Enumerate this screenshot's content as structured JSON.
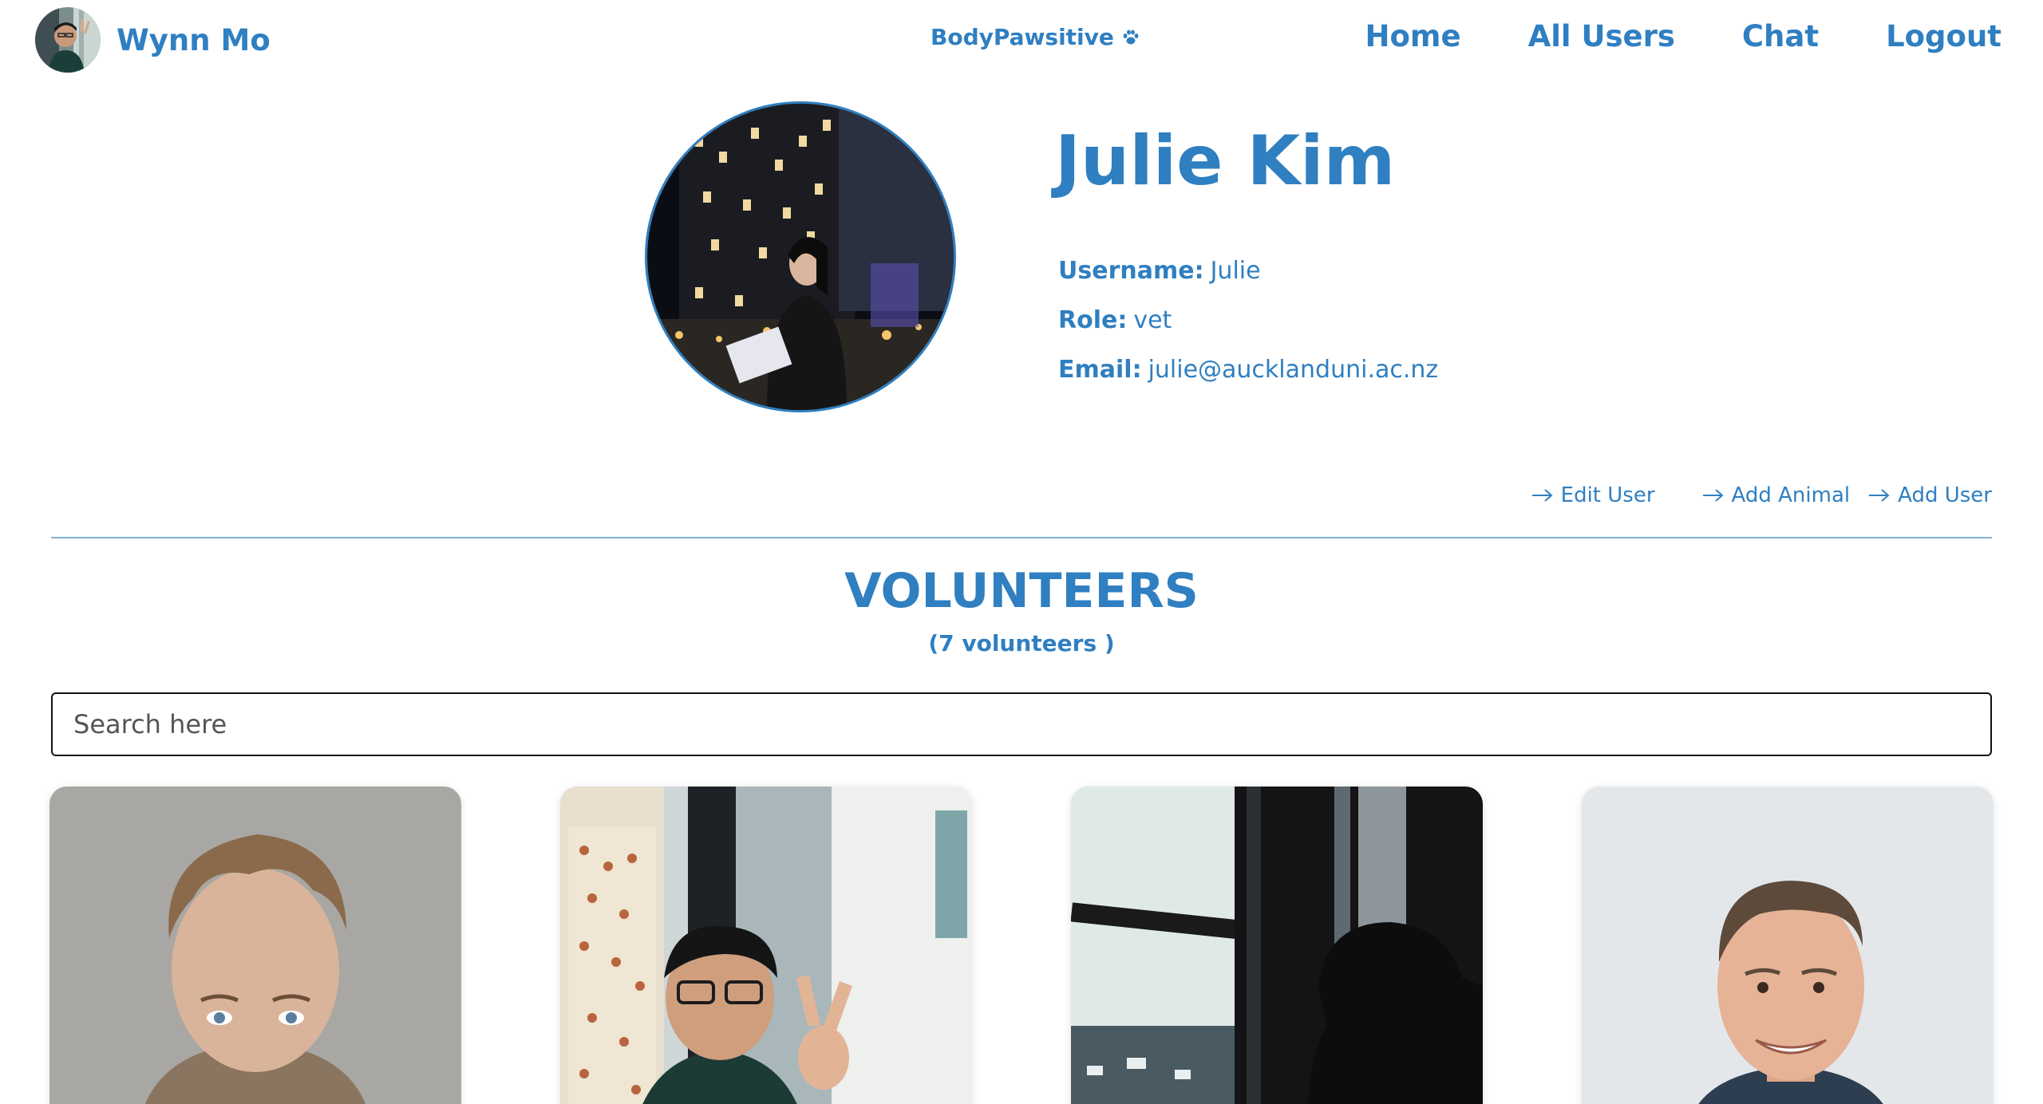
{
  "nav": {
    "user_name": "Wynn Mo",
    "brand": "BodyPawsitive",
    "brand_icon": "paw-icon",
    "links": [
      "Home",
      "All Users",
      "Chat",
      "Logout"
    ]
  },
  "profile": {
    "name": "Julie Kim",
    "username_label": "Username:",
    "username": "Julie",
    "role_label": "Role:",
    "role": "vet",
    "email_label": "Email:",
    "email": "julie@aucklanduni.ac.nz"
  },
  "actions": {
    "edit_user": "Edit User",
    "add_animal": "Add Animal",
    "add_user": "Add User",
    "icon": "arrow-right-icon"
  },
  "volunteers": {
    "title": "VOLUNTEERS",
    "count_text": "(7 volunteers )",
    "search_placeholder": "Search here"
  },
  "colors": {
    "accent": "#2f7fc1",
    "divider": "#7fb3dc"
  }
}
